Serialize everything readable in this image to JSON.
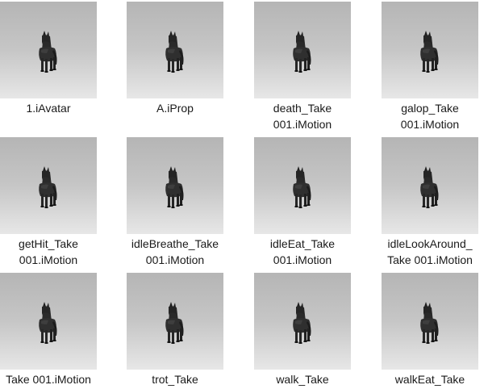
{
  "files": [
    {
      "line1": "1.iAvatar",
      "line2": "",
      "thumbnail_icon": "horse-thumbnail"
    },
    {
      "line1": "A.iProp",
      "line2": "",
      "thumbnail_icon": "horse-thumbnail"
    },
    {
      "line1": "death_Take",
      "line2": "001.iMotion",
      "thumbnail_icon": "horse-thumbnail"
    },
    {
      "line1": "galop_Take",
      "line2": "001.iMotion",
      "thumbnail_icon": "horse-thumbnail"
    },
    {
      "line1": "getHit_Take",
      "line2": "001.iMotion",
      "thumbnail_icon": "horse-thumbnail"
    },
    {
      "line1": "idleBreathe_Take",
      "line2": "001.iMotion",
      "thumbnail_icon": "horse-thumbnail"
    },
    {
      "line1": "idleEat_Take",
      "line2": "001.iMotion",
      "thumbnail_icon": "horse-thumbnail"
    },
    {
      "line1": "idleLookAround_",
      "line2": "Take 001.iMotion",
      "thumbnail_icon": "horse-thumbnail"
    },
    {
      "line1": "Take 001.iMotion",
      "line2": "",
      "thumbnail_icon": "horse-thumbnail"
    },
    {
      "line1": "trot_Take",
      "line2": "",
      "thumbnail_icon": "horse-thumbnail"
    },
    {
      "line1": "walk_Take",
      "line2": "",
      "thumbnail_icon": "horse-thumbnail"
    },
    {
      "line1": "walkEat_Take",
      "line2": "",
      "thumbnail_icon": "horse-thumbnail"
    }
  ]
}
